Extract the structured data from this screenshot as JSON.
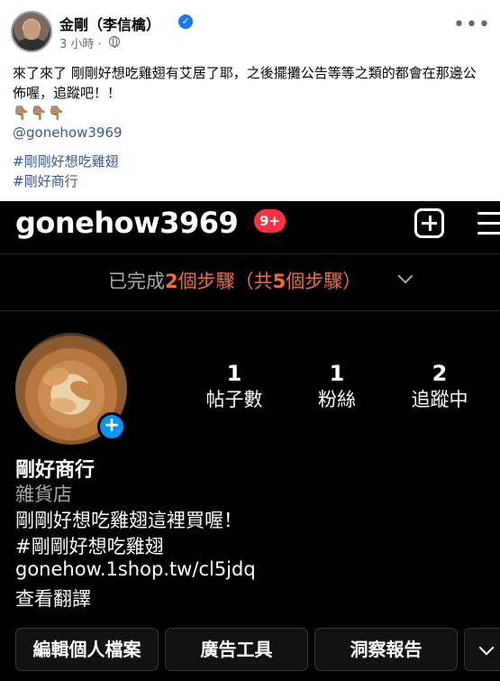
{
  "facebook_post": {
    "author_name": "金剛（李信檎）",
    "time": "3 小時 ·",
    "body": "來了來了 剛剛好想吃雞翅有艾居了耶，之後擺攤公告等等之類的都會在那邊公佈喔，追蹤吧！！",
    "emoji": "👇🏽👇🏽👇🏽",
    "handle_link": "@gonehow3969",
    "hashtags": [
      "#剛剛好想吃雞翅",
      "#剛好商行"
    ]
  },
  "instagram": {
    "username": "gonehow3969",
    "notification_badge": "9+",
    "steps": {
      "prefix": "已完成",
      "done": "2",
      "middle": "個步驟（共",
      "total": "5",
      "suffix": "個步驟）"
    },
    "stats": [
      {
        "count": "1",
        "label": "帖子數"
      },
      {
        "count": "1",
        "label": "粉絲"
      },
      {
        "count": "2",
        "label": "追蹤中"
      }
    ],
    "display_name": "剛好商行",
    "category": "雜貨店",
    "bio_lines": [
      "剛剛好想吃雞翅這裡買喔！",
      "#剛剛好想吃雞翅",
      "gonehow.1shop.tw/cl5jdq",
      "查看翻譯"
    ],
    "buttons": {
      "edit_profile": "編輯個人檔案",
      "ad_tools": "廣告工具",
      "insights": "洞察報告"
    },
    "colors": {
      "background": "#000000",
      "accent": "#f26d3d",
      "badge": "#ff3040",
      "link": "#0095f6"
    }
  }
}
